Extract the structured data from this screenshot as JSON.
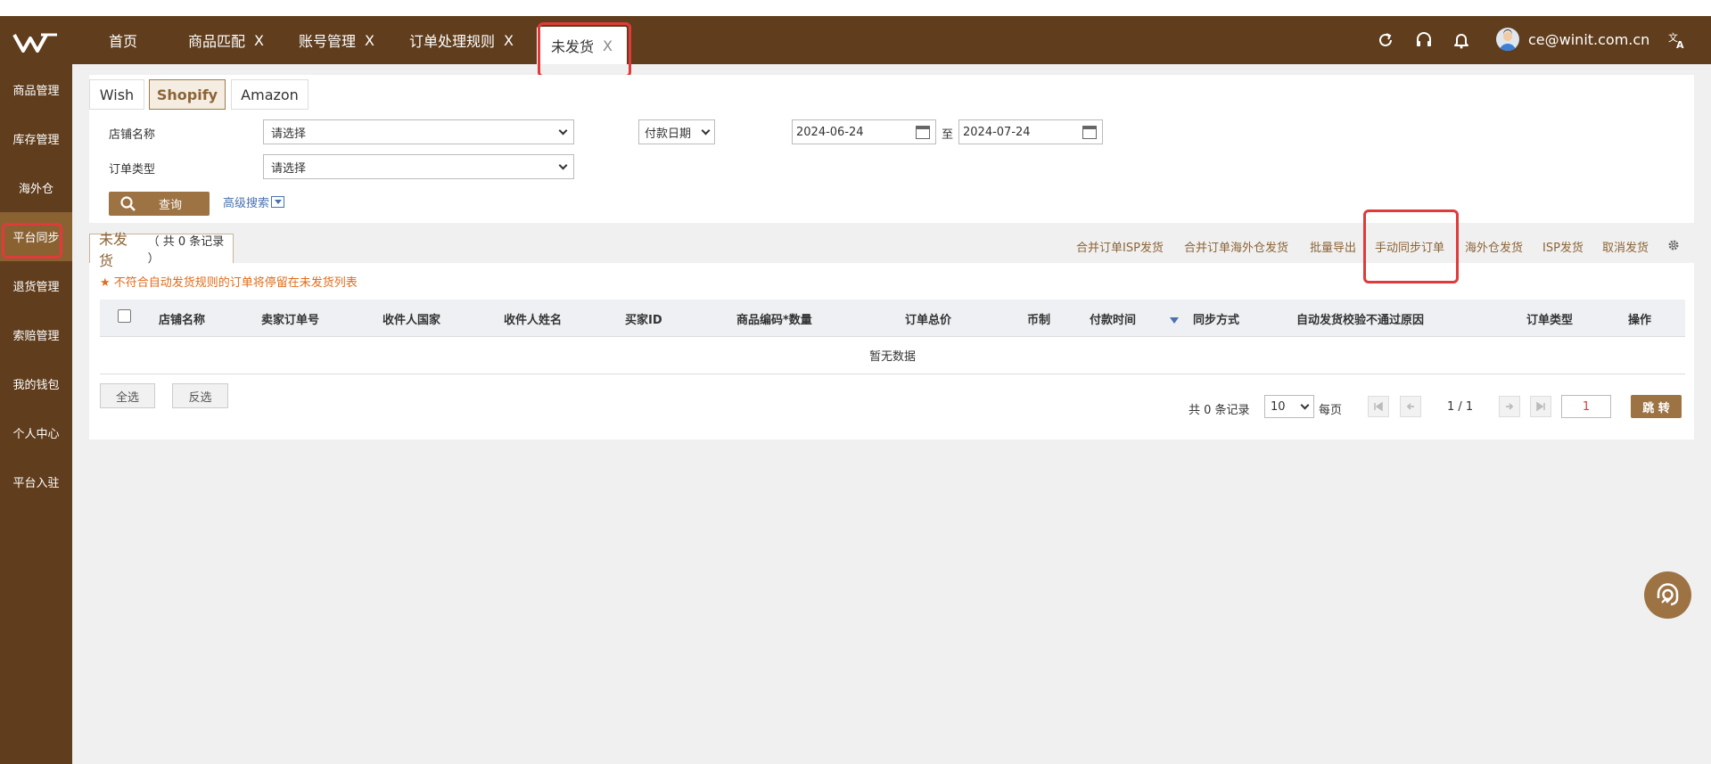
{
  "header": {
    "tabs": [
      {
        "label": "首页",
        "closable": false
      },
      {
        "label": "商品匹配",
        "closable": true
      },
      {
        "label": "账号管理",
        "closable": true
      },
      {
        "label": "订单处理规则",
        "closable": true
      },
      {
        "label": "未发货",
        "closable": true,
        "active": true
      }
    ],
    "close_glyph": "X",
    "user_email": "ce@winit.com.cn",
    "icons": [
      "refresh-icon",
      "headset-icon",
      "bell-icon",
      "translate-icon"
    ]
  },
  "sidebar": {
    "items": [
      {
        "label": "商品管理"
      },
      {
        "label": "库存管理"
      },
      {
        "label": "海外仓"
      },
      {
        "label": "平台同步",
        "active": true
      },
      {
        "label": "退货管理"
      },
      {
        "label": "索赔管理"
      },
      {
        "label": "我的钱包"
      },
      {
        "label": "个人中心"
      },
      {
        "label": "平台入驻"
      }
    ]
  },
  "platform_tabs": [
    {
      "label": "Wish"
    },
    {
      "label": "Shopify",
      "active": true
    },
    {
      "label": "Amazon"
    }
  ],
  "filters": {
    "shop_label": "店铺名称",
    "shop_value": "请选择",
    "order_type_label": "订单类型",
    "order_type_value": "请选择",
    "date_type_value": "付款日期",
    "date_from": "2024-06-24",
    "date_sep": "至",
    "date_to": "2024-07-24",
    "query_label": "查询",
    "advanced_label": "高级搜索"
  },
  "list": {
    "tab_title": "未发货",
    "tab_count": "（ 共 0 条记录 ）",
    "actions": [
      "合并订单ISP发货",
      "合并订单海外仓发货",
      "批量导出",
      "手动同步订单",
      "海外仓发货",
      "ISP发货",
      "取消发货"
    ],
    "notice": "不符合自动发货规则的订单将停留在未发货列表",
    "columns": [
      "店铺名称",
      "卖家订单号",
      "收件人国家",
      "收件人姓名",
      "买家ID",
      "商品编码*数量",
      "订单总价",
      "币制",
      "付款时间",
      "同步方式",
      "自动发货校验不通过原因",
      "订单类型",
      "操作"
    ],
    "empty_text": "暂无数据",
    "select_all": "全选",
    "invert_select": "反选"
  },
  "pagination": {
    "total_text": "共 0 条记录",
    "page_size": "10",
    "per_page_label": "每页",
    "page_info": "1 / 1",
    "goto_value": "1",
    "goto_label": "跳 转"
  },
  "colors": {
    "brand_dark": "#603d1c",
    "brand_accent": "#9d7343",
    "highlight_red": "#e03a3a",
    "notice_orange": "#e06b1a"
  }
}
